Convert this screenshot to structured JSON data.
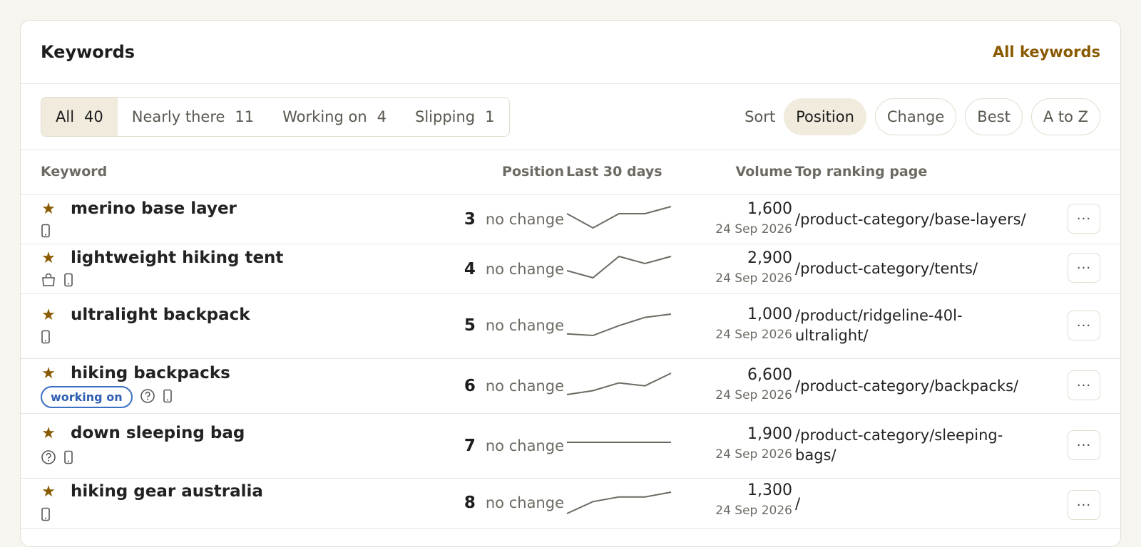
{
  "header": {
    "title": "Keywords",
    "all_link": "All keywords"
  },
  "filters": [
    {
      "label": "All",
      "count": "40",
      "active": true
    },
    {
      "label": "Nearly there",
      "count": "11",
      "active": false
    },
    {
      "label": "Working on",
      "count": "4",
      "active": false
    },
    {
      "label": "Slipping",
      "count": "1",
      "active": false
    }
  ],
  "sort": {
    "label": "Sort",
    "options": [
      "Position",
      "Change",
      "Best",
      "A to Z"
    ],
    "active": "Position"
  },
  "columns": {
    "keyword": "Keyword",
    "position": "Position",
    "last30": "Last 30 days",
    "volume": "Volume",
    "page": "Top ranking page"
  },
  "colors": {
    "accent": "#8a5a00",
    "badge": "#2f5fb3",
    "spark": "#6c6a62"
  },
  "rows": [
    {
      "keyword": "merino base layer",
      "icons": [
        "mobile-icon"
      ],
      "badge": "",
      "position": "3",
      "change": "no change",
      "trend": [
        3,
        5,
        3,
        3,
        2
      ],
      "volume": "1,600",
      "date": "24 Sep 2026",
      "page": "/product-category/base-layers/"
    },
    {
      "keyword": "lightweight hiking tent",
      "icons": [
        "shopping-bag-icon",
        "mobile-icon"
      ],
      "badge": "",
      "position": "4",
      "change": "no change",
      "trend": [
        5,
        6,
        3,
        4,
        3
      ],
      "volume": "2,900",
      "date": "24 Sep 2026",
      "page": "/product-category/tents/"
    },
    {
      "keyword": "ultralight backpack",
      "icons": [
        "mobile-icon"
      ],
      "badge": "",
      "position": "5",
      "change": "no change",
      "trend": [
        8,
        8.2,
        7,
        6,
        5.6
      ],
      "volume": "1,000",
      "date": "24 Sep 2026",
      "page": "/product/ridgeline-40l-ultralight/"
    },
    {
      "keyword": "hiking backpacks",
      "icons": [
        "help-circle-icon",
        "mobile-icon"
      ],
      "badge": "working on",
      "position": "6",
      "change": "no change",
      "trend": [
        8,
        7.6,
        6.8,
        7.1,
        5.8
      ],
      "volume": "6,600",
      "date": "24 Sep 2026",
      "page": "/product-category/backpacks/"
    },
    {
      "keyword": "down sleeping bag",
      "icons": [
        "help-circle-icon",
        "mobile-icon"
      ],
      "badge": "",
      "position": "7",
      "change": "no change",
      "trend": [
        7,
        7,
        7,
        7,
        7
      ],
      "volume": "1,900",
      "date": "24 Sep 2026",
      "page": "/product-category/sleeping-bags/"
    },
    {
      "keyword": "hiking gear australia",
      "icons": [
        "mobile-icon"
      ],
      "badge": "",
      "position": "8",
      "change": "no change",
      "trend": [
        10,
        9,
        8.6,
        8.6,
        8.2
      ],
      "volume": "1,300",
      "date": "24 Sep 2026",
      "page": "/"
    }
  ]
}
